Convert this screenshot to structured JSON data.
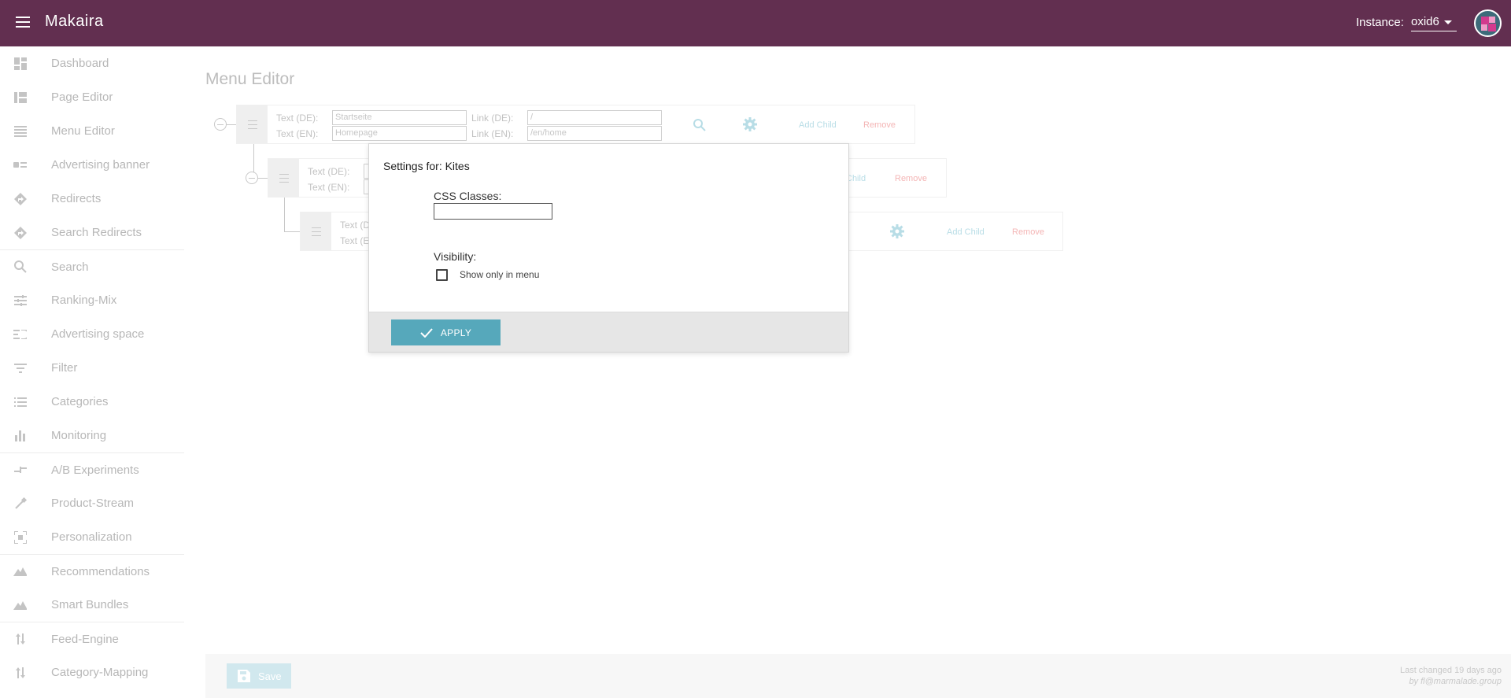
{
  "header": {
    "brand": "Makaira",
    "instance_label": "Instance:",
    "instance_value": "oxid6"
  },
  "sidebar": {
    "items": [
      {
        "label": "Dashboard",
        "icon": "dashboard-icon"
      },
      {
        "label": "Page Editor",
        "icon": "page-editor-icon"
      },
      {
        "label": "Menu Editor",
        "icon": "menu-editor-icon"
      },
      {
        "label": "Advertising banner",
        "icon": "banner-icon"
      },
      {
        "label": "Redirects",
        "icon": "redirect-icon"
      },
      {
        "label": "Search Redirects",
        "icon": "search-redirect-icon"
      },
      {
        "label": "Search",
        "icon": "search-icon"
      },
      {
        "label": "Ranking-Mix",
        "icon": "tune-icon"
      },
      {
        "label": "Advertising space",
        "icon": "ad-space-icon"
      },
      {
        "label": "Filter",
        "icon": "filter-icon"
      },
      {
        "label": "Categories",
        "icon": "list-icon"
      },
      {
        "label": "Monitoring",
        "icon": "bar-chart-icon"
      },
      {
        "label": "A/B Experiments",
        "icon": "experiment-icon"
      },
      {
        "label": "Product-Stream",
        "icon": "dropper-icon"
      },
      {
        "label": "Personalization",
        "icon": "personalization-icon"
      },
      {
        "label": "Recommendations",
        "icon": "recommendations-icon"
      },
      {
        "label": "Smart Bundles",
        "icon": "bundles-icon"
      },
      {
        "label": "Feed-Engine",
        "icon": "sort-arrows-icon"
      },
      {
        "label": "Category-Mapping",
        "icon": "sort-arrows-icon"
      }
    ]
  },
  "main": {
    "title": "Menu Editor",
    "rows": [
      {
        "text_de_label": "Text (DE):",
        "text_en_label": "Text (EN):",
        "text_de_value": "Startseite",
        "text_en_value": "Homepage",
        "link_de_label": "Link (DE):",
        "link_en_label": "Link (EN):",
        "link_de_value": "/",
        "link_en_value": "/en/home",
        "add_child": "Add Child",
        "remove": "Remove"
      },
      {
        "text_de_label": "Text (DE):",
        "text_en_label": "Text (EN):",
        "add_child": "Child",
        "remove": "Remove"
      },
      {
        "text_de_label": "Text (D",
        "text_en_label": "Text (E",
        "add_child": "Add Child",
        "remove": "Remove"
      }
    ]
  },
  "footer": {
    "save_label": "Save",
    "last_changed": "Last changed 19 days ago",
    "by": "by fl@marmalade.group"
  },
  "modal": {
    "title": "Settings for: Kites",
    "css_classes_label": "CSS Classes:",
    "css_classes_value": "",
    "visibility_label": "Visibility:",
    "show_only_in_menu_label": "Show only in menu",
    "show_only_in_menu_checked": false,
    "apply_label": "APPLY"
  },
  "colors": {
    "header_bg": "#622f50",
    "accent": "#56a8bb",
    "remove": "#f4b5b5",
    "add_child": "#b8dde6"
  }
}
